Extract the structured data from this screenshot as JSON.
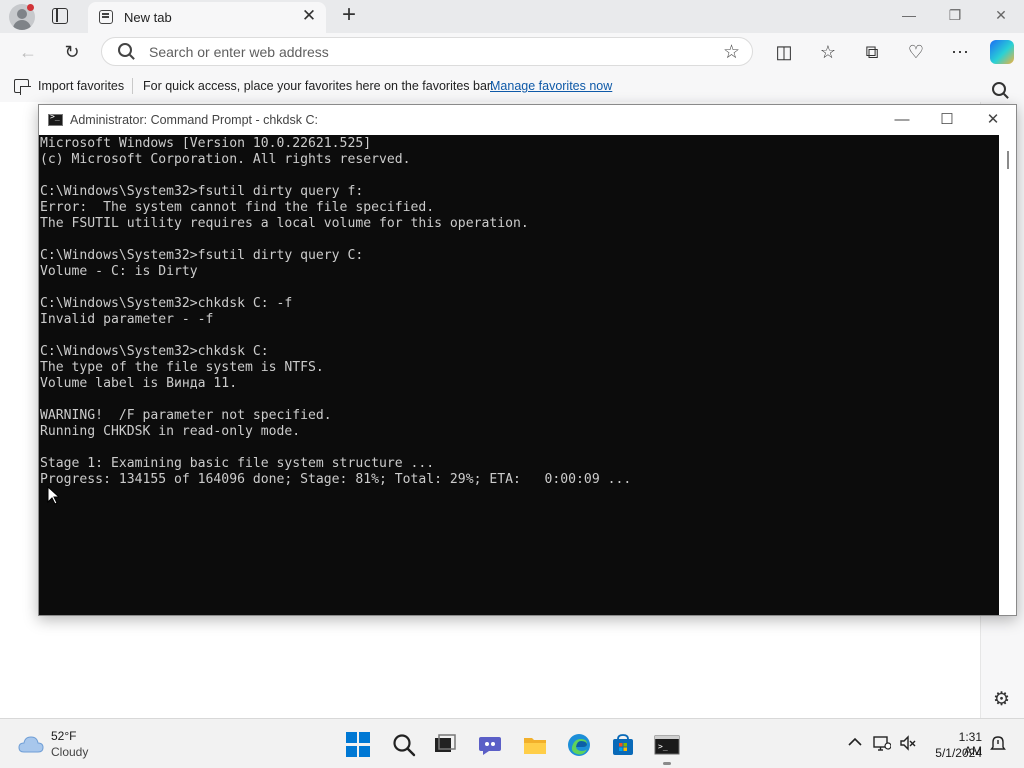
{
  "browser": {
    "tab_title": "New tab",
    "address_placeholder": "Search or enter web address",
    "favorites_bar": {
      "import_label": "Import favorites",
      "message": "For quick access, place your favorites here on the favorites bar.",
      "manage_link": "Manage favorites now"
    }
  },
  "cmd_window": {
    "title": "Administrator: Command Prompt - chkdsk  C:",
    "lines": [
      "Microsoft Windows [Version 10.0.22621.525]",
      "(c) Microsoft Corporation. All rights reserved.",
      "",
      "C:\\Windows\\System32>fsutil dirty query f:",
      "Error:  The system cannot find the file specified.",
      "The FSUTIL utility requires a local volume for this operation.",
      "",
      "C:\\Windows\\System32>fsutil dirty query C:",
      "Volume - C: is Dirty",
      "",
      "C:\\Windows\\System32>chkdsk C: -f",
      "Invalid parameter - -f",
      "",
      "C:\\Windows\\System32>chkdsk C:",
      "The type of the file system is NTFS.",
      "Volume label is Винда 11.",
      "",
      "WARNING!  /F parameter not specified.",
      "Running CHKDSK in read-only mode.",
      "",
      "Stage 1: Examining basic file system structure ...",
      "Progress: 134155 of 164096 done; Stage: 81%; Total: 29%; ETA:   0:00:09 ..."
    ]
  },
  "taskbar": {
    "weather_temp": "52°F",
    "weather_condition": "Cloudy",
    "time": "1:31 AM",
    "date": "5/1/2024",
    "apps": [
      "start",
      "search",
      "task-view",
      "chat",
      "file-explorer",
      "edge",
      "store",
      "command-prompt"
    ]
  },
  "colors": {
    "terminal_bg": "#0c0c0c",
    "terminal_fg": "#cccccc",
    "link": "#0f5aa8",
    "accent": "#0078d4"
  }
}
